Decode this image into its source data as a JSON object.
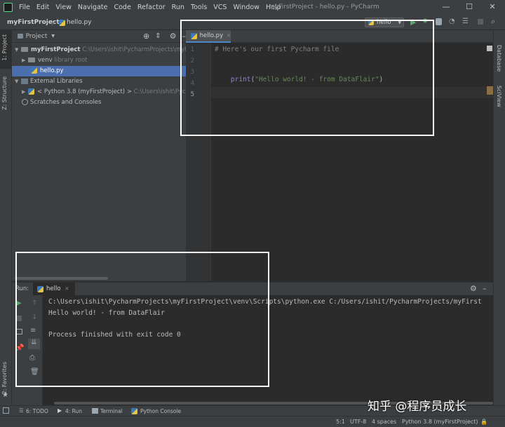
{
  "titlebar": {
    "menu": [
      "File",
      "Edit",
      "View",
      "Navigate",
      "Code",
      "Refactor",
      "Run",
      "Tools",
      "VCS",
      "Window",
      "Help"
    ],
    "title": "myFirstProject - hello.py - PyCharm"
  },
  "navbar": {
    "project": "myFirstProject",
    "file": "hello.py",
    "run_config": "hello"
  },
  "left_strip": {
    "project": "1: Project",
    "structure": "Z: Structure",
    "favorites": "2: Favorites"
  },
  "right_strip": {
    "database": "Database",
    "sciview": "SciView"
  },
  "project_panel": {
    "header": "Project",
    "root": "myFirstProject",
    "root_path": "C:\\Users\\ishit\\PycharmProjects\\myFirstP",
    "venv": "venv",
    "venv_note": "library root",
    "file": "hello.py",
    "external": "External Libraries",
    "python": "< Python 3.8 (myFirstProject) >",
    "python_path": "C:\\Users\\ishit\\Pychar",
    "scratches": "Scratches and Consoles"
  },
  "editor": {
    "tab": "hello.py",
    "line_numbers": [
      "1",
      "2",
      "3",
      "4",
      "5"
    ],
    "line1": "# Here's our first Pycharm file",
    "line3_func": "print",
    "line3_paren_open": "(",
    "line3_string": "\"Hello world! - from DataFlair\"",
    "line3_paren_close": ")"
  },
  "run_panel": {
    "label": "Run:",
    "tab": "hello",
    "cmd": "C:\\Users\\ishit\\PycharmProjects\\myFirstProject\\venv\\Scripts\\python.exe C:/Users/ishit/PycharmProjects/myFirst",
    "output": "Hello world! - from DataFlair",
    "exit": "Process finished with exit code 0"
  },
  "tool_windows": {
    "todo": "6: TODO",
    "run": "4: Run",
    "terminal": "Terminal",
    "console": "Python Console"
  },
  "status": {
    "position": "5:1",
    "encoding": "UTF-8",
    "indent": "4 spaces",
    "interpreter": "Python 3.8 (myFirstProject)"
  },
  "watermark": "知乎 @程序员成长"
}
